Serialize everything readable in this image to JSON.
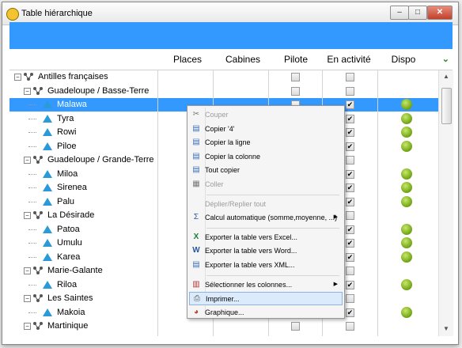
{
  "window": {
    "title": "Table hiérarchique"
  },
  "columns": [
    "Places",
    "Cabines",
    "Pilote",
    "En activité",
    "Dispo"
  ],
  "rows": [
    {
      "label": "Antilles françaises",
      "level": 0,
      "type": "group",
      "pilote": false,
      "activite": false,
      "dispo": false,
      "selected": false
    },
    {
      "label": "Guadeloupe / Basse-Terre",
      "level": 1,
      "type": "group",
      "pilote": false,
      "activite": false,
      "dispo": false,
      "selected": false
    },
    {
      "label": "Malawa",
      "level": 2,
      "type": "leaf",
      "pilote": false,
      "activite": true,
      "dispo": true,
      "selected": true
    },
    {
      "label": "Tyra",
      "level": 2,
      "type": "leaf",
      "pilote": false,
      "activite": true,
      "dispo": true,
      "selected": false
    },
    {
      "label": "Rowi",
      "level": 2,
      "type": "leaf",
      "pilote": false,
      "activite": true,
      "dispo": true,
      "selected": false
    },
    {
      "label": "Piloe",
      "level": 2,
      "type": "leaf",
      "pilote": false,
      "activite": true,
      "dispo": true,
      "selected": false
    },
    {
      "label": "Guadeloupe / Grande-Terre",
      "level": 1,
      "type": "group",
      "pilote": false,
      "activite": false,
      "dispo": false,
      "selected": false
    },
    {
      "label": "Miloa",
      "level": 2,
      "type": "leaf",
      "pilote": false,
      "activite": true,
      "dispo": true,
      "selected": false
    },
    {
      "label": "Sirenea",
      "level": 2,
      "type": "leaf",
      "pilote": false,
      "activite": true,
      "dispo": true,
      "selected": false
    },
    {
      "label": "Palu",
      "level": 2,
      "type": "leaf",
      "pilote": false,
      "activite": true,
      "dispo": true,
      "selected": false
    },
    {
      "label": "La Désirade",
      "level": 1,
      "type": "group",
      "pilote": false,
      "activite": false,
      "dispo": false,
      "selected": false
    },
    {
      "label": "Patoa",
      "level": 2,
      "type": "leaf",
      "pilote": false,
      "activite": true,
      "dispo": true,
      "selected": false
    },
    {
      "label": "Umulu",
      "level": 2,
      "type": "leaf",
      "pilote": false,
      "activite": true,
      "dispo": true,
      "selected": false
    },
    {
      "label": "Karea",
      "level": 2,
      "type": "leaf",
      "pilote": false,
      "activite": true,
      "dispo": true,
      "selected": false
    },
    {
      "label": "Marie-Galante",
      "level": 1,
      "type": "group",
      "pilote": false,
      "activite": false,
      "dispo": false,
      "selected": false
    },
    {
      "label": "Riloa",
      "level": 2,
      "type": "leaf",
      "pilote": false,
      "activite": true,
      "dispo": true,
      "selected": false
    },
    {
      "label": "Les Saintes",
      "level": 1,
      "type": "group",
      "pilote": false,
      "activite": false,
      "dispo": false,
      "selected": false
    },
    {
      "label": "Makoia",
      "level": 2,
      "type": "leaf",
      "pilote": false,
      "activite": true,
      "dispo": true,
      "selected": false
    },
    {
      "label": "Martinique",
      "level": 1,
      "type": "group",
      "pilote": false,
      "activite": false,
      "dispo": false,
      "selected": false
    }
  ],
  "context_menu": [
    {
      "label": "Couper",
      "icon": "cut-icon",
      "disabled": true
    },
    {
      "label": "Copier '4'",
      "icon": "copy-icon",
      "disabled": false
    },
    {
      "label": "Copier la ligne",
      "icon": "copy-row-icon",
      "disabled": false
    },
    {
      "label": "Copier la colonne",
      "icon": "copy-column-icon",
      "disabled": false
    },
    {
      "label": "Tout copier",
      "icon": "copy-all-icon",
      "disabled": false
    },
    {
      "label": "Coller",
      "icon": "paste-icon",
      "disabled": true
    },
    {
      "sep": true
    },
    {
      "label": "Déplier/Replier tout",
      "icon": "",
      "disabled": true
    },
    {
      "label": "Calcul automatique (somme,moyenne, ...)",
      "icon": "sigma-icon",
      "disabled": false,
      "submenu": true
    },
    {
      "sep": true
    },
    {
      "label": "Exporter la table vers Excel...",
      "icon": "excel-icon",
      "disabled": false
    },
    {
      "label": "Exporter la table vers Word...",
      "icon": "word-icon",
      "disabled": false
    },
    {
      "label": "Exporter la table vers XML...",
      "icon": "xml-icon",
      "disabled": false
    },
    {
      "sep": true
    },
    {
      "label": "Sélectionner les colonnes...",
      "icon": "columns-icon",
      "disabled": false,
      "submenu": true
    },
    {
      "label": "Imprimer...",
      "icon": "print-icon",
      "disabled": false,
      "hover": true
    },
    {
      "label": "Graphique...",
      "icon": "chart-icon",
      "disabled": false
    }
  ],
  "colors": {
    "accent": "#3399ff",
    "dispo": "#6ea312"
  }
}
